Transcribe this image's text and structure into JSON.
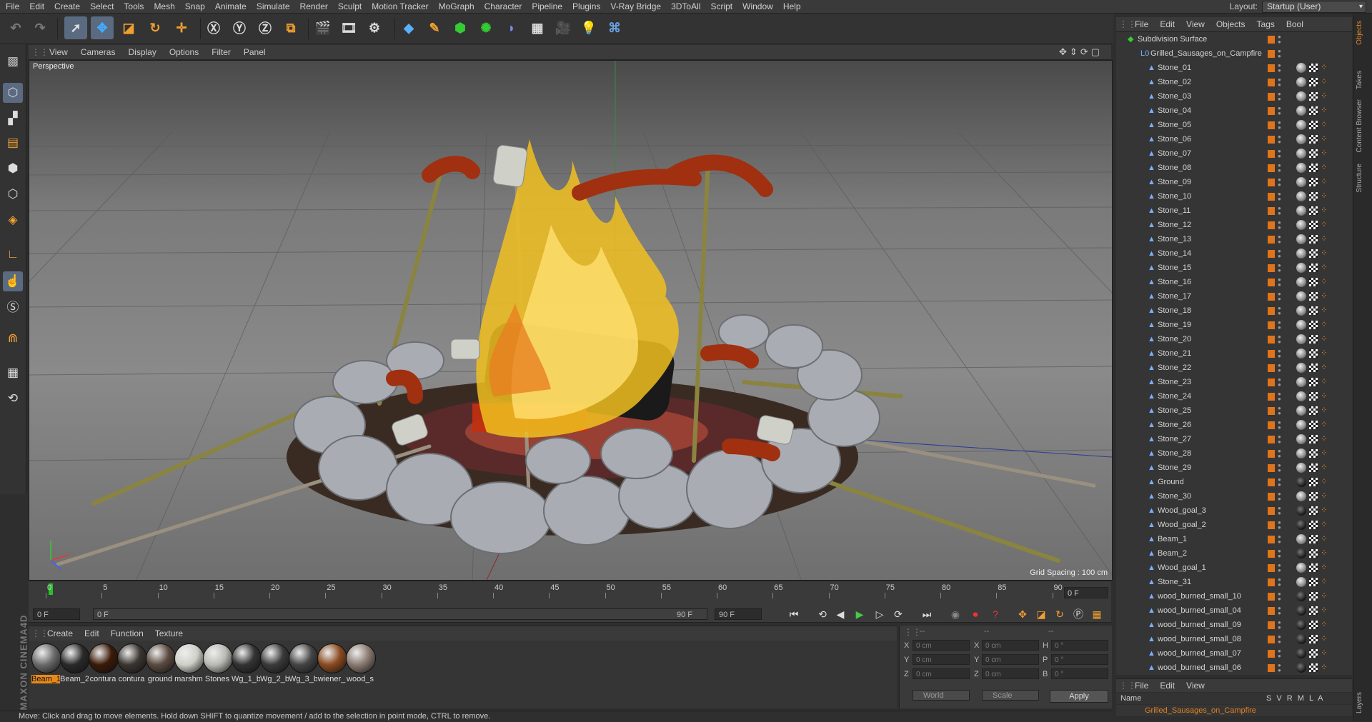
{
  "menu": [
    "File",
    "Edit",
    "Create",
    "Select",
    "Tools",
    "Mesh",
    "Snap",
    "Animate",
    "Simulate",
    "Render",
    "Sculpt",
    "Motion Tracker",
    "MoGraph",
    "Character",
    "Pipeline",
    "Plugins",
    "V-Ray Bridge",
    "3DToAll",
    "Script",
    "Window",
    "Help"
  ],
  "layout": {
    "label": "Layout:",
    "value": "Startup (User)"
  },
  "viewport": {
    "menu": [
      "View",
      "Cameras",
      "Display",
      "Options",
      "Filter",
      "Panel"
    ],
    "mode_label": "Perspective",
    "grid_spacing": "Grid Spacing : 100 cm"
  },
  "timeline": {
    "ticks": [
      "0",
      "5",
      "10",
      "15",
      "20",
      "25",
      "30",
      "35",
      "40",
      "45",
      "50",
      "55",
      "60",
      "65",
      "70",
      "75",
      "80",
      "85",
      "90"
    ],
    "frame_end": "0 F",
    "current_frame": "0 F",
    "slider_start": "0 F",
    "slider_end": "90 F",
    "max_frame": "90 F"
  },
  "materials": {
    "menu": [
      "Create",
      "Edit",
      "Function",
      "Texture"
    ],
    "items": [
      {
        "label": "Beam_1",
        "color": "#6a6a6a",
        "selected": true
      },
      {
        "label": "Beam_2",
        "color": "#2a2a2a"
      },
      {
        "label": "contura",
        "color": "#3a1a08"
      },
      {
        "label": "contura",
        "color": "#3a3530"
      },
      {
        "label": "ground",
        "color": "#5a4a40"
      },
      {
        "label": "marshm",
        "color": "#cfcfc8"
      },
      {
        "label": "Stones",
        "color": "#b9b9b4"
      },
      {
        "label": "Wg_1_b",
        "color": "#333"
      },
      {
        "label": "Wg_2_b",
        "color": "#3a3a3a"
      },
      {
        "label": "Wg_3_b",
        "color": "#444"
      },
      {
        "label": "wiener_",
        "color": "#8a4a20"
      },
      {
        "label": "wood_s",
        "color": "#8a7a70"
      }
    ]
  },
  "coords": {
    "headers": [
      "--",
      "--",
      "--"
    ],
    "rows": [
      {
        "a": "X",
        "av": "0 cm",
        "b": "X",
        "bv": "0 cm",
        "c": "H",
        "cv": "0 °"
      },
      {
        "a": "Y",
        "av": "0 cm",
        "b": "Y",
        "bv": "0 cm",
        "c": "P",
        "cv": "0 °"
      },
      {
        "a": "Z",
        "av": "0 cm",
        "b": "Z",
        "bv": "0 cm",
        "c": "B",
        "cv": "0 °"
      }
    ],
    "space": "World",
    "mode": "Scale",
    "apply": "Apply"
  },
  "status": "Move: Click and drag to move elements. Hold down SHIFT to quantize movement / add to the selection in point mode, CTRL to remove.",
  "object_manager": {
    "menu": [
      "File",
      "Edit",
      "View",
      "Objects",
      "Tags",
      "Bool"
    ],
    "root": "Subdivision Surface",
    "group": "Grilled_Sausages_on_Campfire",
    "objects": [
      {
        "name": "Stone_01"
      },
      {
        "name": "Stone_02"
      },
      {
        "name": "Stone_03"
      },
      {
        "name": "Stone_04"
      },
      {
        "name": "Stone_05"
      },
      {
        "name": "Stone_06"
      },
      {
        "name": "Stone_07"
      },
      {
        "name": "Stone_08"
      },
      {
        "name": "Stone_09"
      },
      {
        "name": "Stone_10"
      },
      {
        "name": "Stone_11"
      },
      {
        "name": "Stone_12"
      },
      {
        "name": "Stone_13"
      },
      {
        "name": "Stone_14"
      },
      {
        "name": "Stone_15"
      },
      {
        "name": "Stone_16"
      },
      {
        "name": "Stone_17"
      },
      {
        "name": "Stone_18"
      },
      {
        "name": "Stone_19"
      },
      {
        "name": "Stone_20"
      },
      {
        "name": "Stone_21"
      },
      {
        "name": "Stone_22"
      },
      {
        "name": "Stone_23"
      },
      {
        "name": "Stone_24"
      },
      {
        "name": "Stone_25"
      },
      {
        "name": "Stone_26"
      },
      {
        "name": "Stone_27"
      },
      {
        "name": "Stone_28"
      },
      {
        "name": "Stone_29"
      },
      {
        "name": "Ground",
        "dark": true
      },
      {
        "name": "Stone_30"
      },
      {
        "name": "Wood_goal_3",
        "dark": true
      },
      {
        "name": "Wood_goal_2",
        "dark": true
      },
      {
        "name": "Beam_1"
      },
      {
        "name": "Beam_2",
        "dark": true
      },
      {
        "name": "Wood_goal_1"
      },
      {
        "name": "Stone_31"
      },
      {
        "name": "wood_burned_small_10",
        "dark": true
      },
      {
        "name": "wood_burned_small_04",
        "dark": true
      },
      {
        "name": "wood_burned_small_09",
        "dark": true
      },
      {
        "name": "wood_burned_small_08",
        "dark": true
      },
      {
        "name": "wood_burned_small_07",
        "dark": true
      },
      {
        "name": "wood_burned_small_06",
        "dark": true
      }
    ],
    "bottom_menu": [
      "File",
      "Edit",
      "View"
    ],
    "columns": {
      "name": "Name",
      "flags": "S V R M L A"
    },
    "attr_row": "Grilled_Sausages_on_Campfire"
  },
  "side_tabs": [
    "Objects",
    "Takes",
    "Content Browser",
    "Structure",
    "Layers"
  ]
}
